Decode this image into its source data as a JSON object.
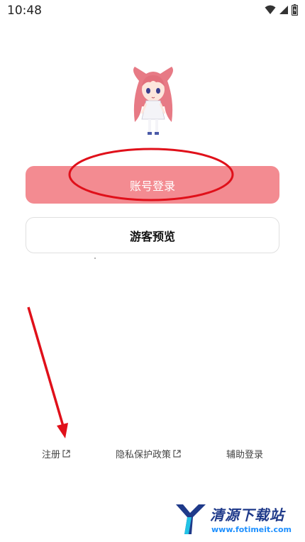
{
  "status_bar": {
    "time": "10:48",
    "icons": [
      "wifi-icon",
      "cellular-signal-icon",
      "battery-icon"
    ]
  },
  "mascot": {
    "icon": "anime-girl-mascot"
  },
  "buttons": {
    "account_login": "账号登录",
    "guest_preview": "游客预览"
  },
  "colors": {
    "primary": "#f38b91",
    "annotation": "#e0101a",
    "link_text": "#444444"
  },
  "links": {
    "register": "注册",
    "privacy_policy": "隐私保护政策",
    "assist_login": "辅助登录"
  },
  "watermark": {
    "title": "清源下载站",
    "url": "www.fotimeit.com"
  }
}
